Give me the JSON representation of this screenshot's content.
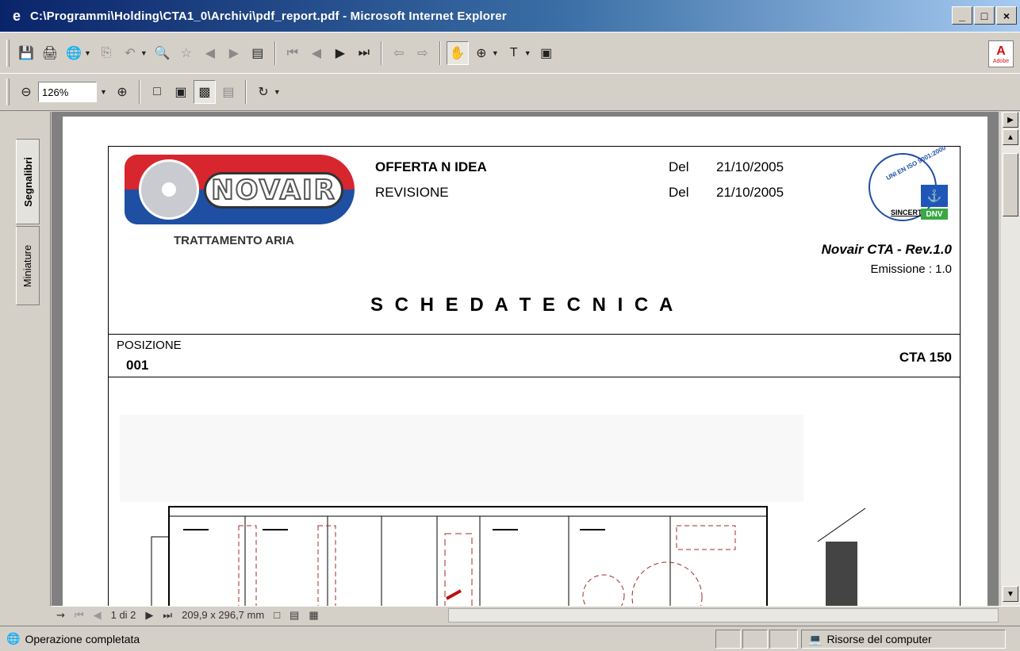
{
  "window": {
    "title": "C:\\Programmi\\Holding\\CTA1_0\\Archivi\\pdf_report.pdf - Microsoft Internet Explorer",
    "minimize": "_",
    "maximize": "□",
    "close": "×"
  },
  "toolbar": {
    "zoom_value": "126%",
    "adobe_label": "Adobe"
  },
  "side_tabs": {
    "bookmarks": "Segnalibri",
    "thumbnails": "Miniature"
  },
  "document": {
    "logo_word": "NOVAIR",
    "logo_subtitle": "TRATTAMENTO ARIA",
    "offer_label": "OFFERTA N IDEA",
    "revision_label": "REVISIONE",
    "del_label_1": "Del",
    "del_date_1": "21/10/2005",
    "del_label_2": "Del",
    "del_date_2": "21/10/2005",
    "cert_sincert": "SINCERT",
    "cert_dnv": "DNV",
    "product_rev": "Novair CTA - Rev.1.0",
    "emission": "Emissione : 1.0",
    "sheet_title": "S C H E D A    T E C N I C A",
    "position_label": "POSIZIONE",
    "position_value": "001",
    "model": "CTA 150"
  },
  "page_nav": {
    "page_indicator": "1 di 2",
    "page_size": "209,9 x 296,7 mm"
  },
  "statusbar": {
    "message": "Operazione completata",
    "zone": "Risorse del computer"
  },
  "colors": {
    "titlebar_start": "#0a246a",
    "logo_red": "#d7262e",
    "logo_blue": "#1e4fa3",
    "drawing_red": "#a52a2a"
  }
}
